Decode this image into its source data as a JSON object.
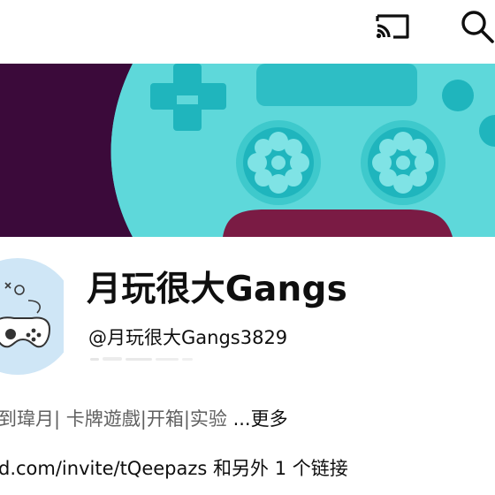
{
  "topbar": {
    "cast_icon": "cast-icon",
    "search_icon": "search-icon"
  },
  "banner": {
    "colors": {
      "left_panel": "#3b0a3a",
      "background": "#4fd4d6",
      "controller_detail": "#1fb5bd",
      "trigger": "#7a1b44"
    }
  },
  "channel": {
    "name": "月玩很大Gangs",
    "handle": "@月玩很大Gangs3829",
    "description": "到瑋月| 卡牌遊戲|开箱|实验 ",
    "more_label": "...更多",
    "link_url": "d.com/invite/tQeepazs",
    "link_extra": " 和另外 1 个链接"
  },
  "colors": {
    "text_primary": "#0f0f0f",
    "text_secondary": "#606060"
  }
}
